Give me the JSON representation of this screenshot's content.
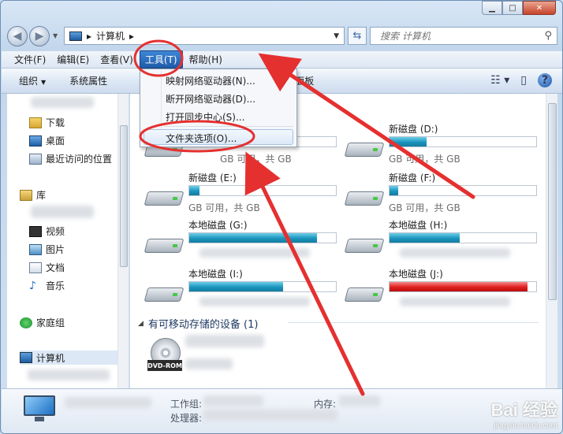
{
  "window": {
    "minimize_glyph": "▁",
    "maximize_glyph": "□",
    "close_glyph": "✕"
  },
  "address_bar": {
    "breadcrumb": "计算机",
    "separator": "▸",
    "search_placeholder": "搜索 计算机"
  },
  "menubar": {
    "items": [
      "文件(F)",
      "编辑(E)",
      "查看(V)",
      "工具(T)",
      "帮助(H)"
    ],
    "active_index": 3
  },
  "toolbar": {
    "organize": "组织",
    "system_properties": "系统属性",
    "control_panel": "打开控制面板"
  },
  "tools_menu": {
    "items": [
      "映射网络驱动器(N)...",
      "断开网络驱动器(D)...",
      "打开同步中心(S)...",
      "文件夹选项(O)..."
    ]
  },
  "sidebar": {
    "downloads": "下载",
    "desktop": "桌面",
    "recent": "最近访问的位置",
    "libraries": "库",
    "videos": "视频",
    "pictures": "图片",
    "documents": "文档",
    "music": "音乐",
    "homegroup": "家庭组",
    "computer": "计算机"
  },
  "drives": [
    {
      "name": "新磁盘 (D:)",
      "fill": 0.25,
      "color": "blue",
      "caption": "GB 可用，共      GB"
    },
    {
      "name": "新磁盘 (E:)",
      "fill": 0.07,
      "color": "blue",
      "caption": "GB 可用，共      GB"
    },
    {
      "name": "新磁盘 (F:)",
      "fill": 0.06,
      "color": "blue",
      "caption": "GB 可用，共      GB"
    },
    {
      "name": "本地磁盘 (G:)",
      "fill": 0.87,
      "color": "blue",
      "caption": ""
    },
    {
      "name": "本地磁盘 (H:)",
      "fill": 0.48,
      "color": "blue",
      "caption": ""
    },
    {
      "name": "本地磁盘 (I:)",
      "fill": 0.64,
      "color": "blue",
      "caption": ""
    },
    {
      "name": "本地磁盘 (J:)",
      "fill": 0.94,
      "color": "red",
      "caption": ""
    }
  ],
  "first_drive_caption": "GB 可用，共      GB",
  "removable_header": "有可移动存储的设备 (1)",
  "dvd_label": "DVD-ROM",
  "details": {
    "workgroup_label": "工作组:",
    "processor_label": "处理器:",
    "memory_label": "内存:"
  },
  "watermark": {
    "brand": "Bai 经验",
    "url": "jingyan.baidu.com"
  }
}
